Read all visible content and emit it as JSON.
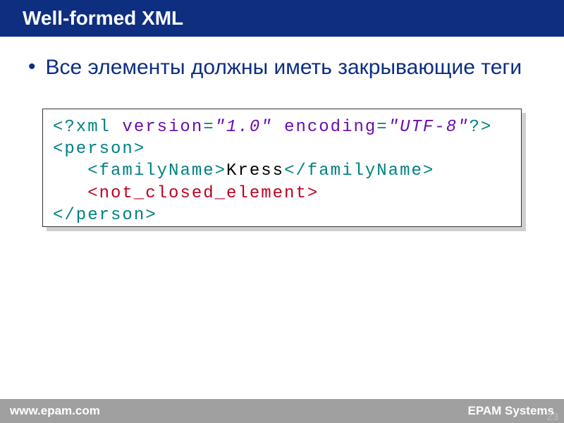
{
  "header": {
    "title": "Well-formed XML"
  },
  "bullet": {
    "dot": "•",
    "text": "Все элементы должны иметь закрывающие теги"
  },
  "code": {
    "l1": {
      "a": "<?xml ",
      "b": "version",
      "c": "=",
      "d": "\"1.0\"",
      "e": " encoding",
      "f": "=",
      "g": "\"UTF-8\"",
      "h": "?>"
    },
    "l2": "<person>",
    "l3": {
      "indent": "   ",
      "open": "<familyName>",
      "value": "Kress",
      "close": "</familyName>"
    },
    "l4": {
      "indent": "   ",
      "tag": "<not_closed_element>"
    },
    "l5": "</person>"
  },
  "footer": {
    "left": "www.epam.com",
    "right": "EPAM Systems"
  },
  "page": "23"
}
